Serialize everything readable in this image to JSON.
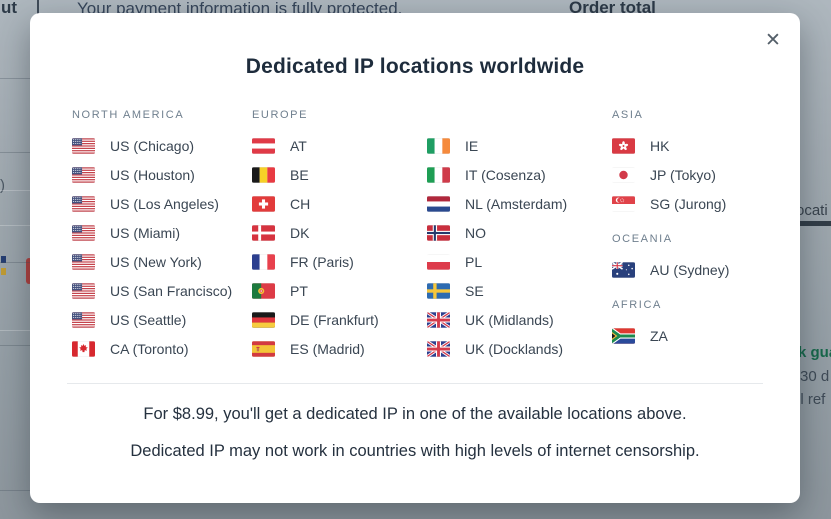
{
  "backdrop": {
    "checkout_partial": "ut",
    "payment_note": "Your payment information is fully protected.",
    "order_total": "Order total",
    "locations_tab_partial": "ocati",
    "guarantee_partial": "k gua",
    "days_partial": "30 d",
    "refund_partial": "ll ref",
    "paren_partial": ")"
  },
  "modal": {
    "title": "Dedicated IP locations worldwide",
    "close_icon": "✕",
    "columns": [
      {
        "groups": [
          {
            "header": "NORTH AMERICA",
            "items": [
              {
                "flag": "us",
                "label": "US (Chicago)"
              },
              {
                "flag": "us",
                "label": "US (Houston)"
              },
              {
                "flag": "us",
                "label": "US (Los Angeles)"
              },
              {
                "flag": "us",
                "label": "US (Miami)"
              },
              {
                "flag": "us",
                "label": "US (New York)"
              },
              {
                "flag": "us",
                "label": "US (San Francisco)"
              },
              {
                "flag": "us",
                "label": "US (Seattle)"
              },
              {
                "flag": "ca",
                "label": "CA (Toronto)"
              }
            ]
          }
        ]
      },
      {
        "groups": [
          {
            "header": "EUROPE",
            "items": [
              {
                "flag": "at",
                "label": "AT"
              },
              {
                "flag": "be",
                "label": "BE"
              },
              {
                "flag": "ch",
                "label": "CH"
              },
              {
                "flag": "dk",
                "label": "DK"
              },
              {
                "flag": "fr",
                "label": "FR (Paris)"
              },
              {
                "flag": "pt",
                "label": "PT"
              },
              {
                "flag": "de",
                "label": "DE (Frankfurt)"
              },
              {
                "flag": "es",
                "label": "ES (Madrid)"
              }
            ]
          }
        ]
      },
      {
        "groups": [
          {
            "header": "",
            "items": [
              {
                "flag": "ie",
                "label": "IE"
              },
              {
                "flag": "it",
                "label": "IT (Cosenza)"
              },
              {
                "flag": "nl",
                "label": "NL (Amsterdam)"
              },
              {
                "flag": "no",
                "label": "NO"
              },
              {
                "flag": "pl",
                "label": "PL"
              },
              {
                "flag": "se",
                "label": "SE"
              },
              {
                "flag": "gb",
                "label": "UK (Midlands)"
              },
              {
                "flag": "gb",
                "label": "UK (Docklands)"
              }
            ]
          }
        ]
      },
      {
        "groups": [
          {
            "header": "ASIA",
            "items": [
              {
                "flag": "hk",
                "label": "HK"
              },
              {
                "flag": "jp",
                "label": "JP (Tokyo)"
              },
              {
                "flag": "sg",
                "label": "SG (Jurong)"
              }
            ]
          },
          {
            "header": "OCEANIA",
            "items": [
              {
                "flag": "au",
                "label": "AU (Sydney)"
              }
            ]
          },
          {
            "header": "AFRICA",
            "items": [
              {
                "flag": "za",
                "label": "ZA"
              }
            ]
          }
        ]
      }
    ],
    "footer_line1": "For $8.99, you'll get a dedicated IP in one of the available locations above.",
    "footer_line2": "Dedicated IP may not work in countries with high levels of internet censorship."
  },
  "colors": {
    "modal_bg": "#ffffff",
    "backdrop_gray": "#98a2a9",
    "title_text": "#1e2c3c",
    "section_header_text": "#6f7f8e",
    "item_text": "#3a4653",
    "backdrop_green": "#17684b",
    "tab_underline": "#323d47"
  }
}
